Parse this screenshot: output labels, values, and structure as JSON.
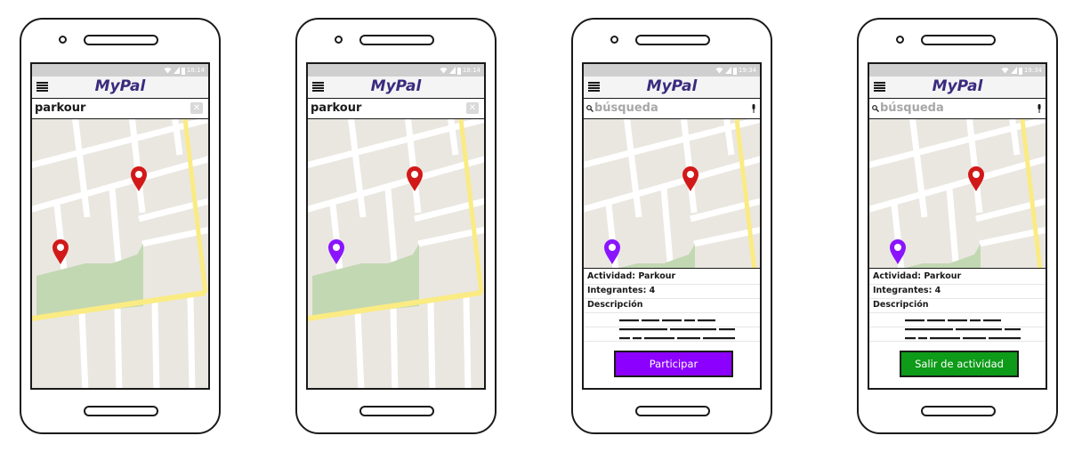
{
  "app": {
    "title": "MyPal"
  },
  "colors": {
    "brand": "#3a2b7e",
    "pin_red": "#d21919",
    "pin_purple": "#8b14ff",
    "map_land": "#eae7e1",
    "map_park": "#c2d8b2",
    "map_highway": "#faeb83",
    "button_purple": "#8b00ff",
    "button_green": "#0d9b19"
  },
  "screens": [
    {
      "time": "18:14",
      "search": {
        "value": "parkour",
        "clear_icon": "close-icon"
      }
    },
    {
      "time": "18:14",
      "search": {
        "value": "parkour",
        "clear_icon": "close-icon"
      }
    },
    {
      "time": "19:34",
      "search": {
        "placeholder": "búsqueda",
        "icons": [
          "search-icon",
          "microphone-icon"
        ]
      },
      "details": {
        "activity": "Actividad: Parkour",
        "members": "Integrantes: 4",
        "description_label": "Descripción"
      },
      "button": {
        "label": "Participar",
        "color": "#8b00ff"
      }
    },
    {
      "time": "19:34",
      "search": {
        "placeholder": "búsqueda",
        "icons": [
          "search-icon",
          "microphone-icon"
        ]
      },
      "details": {
        "activity": "Actividad: Parkour",
        "members": "Integrantes: 4",
        "description_label": "Descripción"
      },
      "button": {
        "label": "Salir de actividad",
        "color": "#0d9b19"
      }
    }
  ]
}
